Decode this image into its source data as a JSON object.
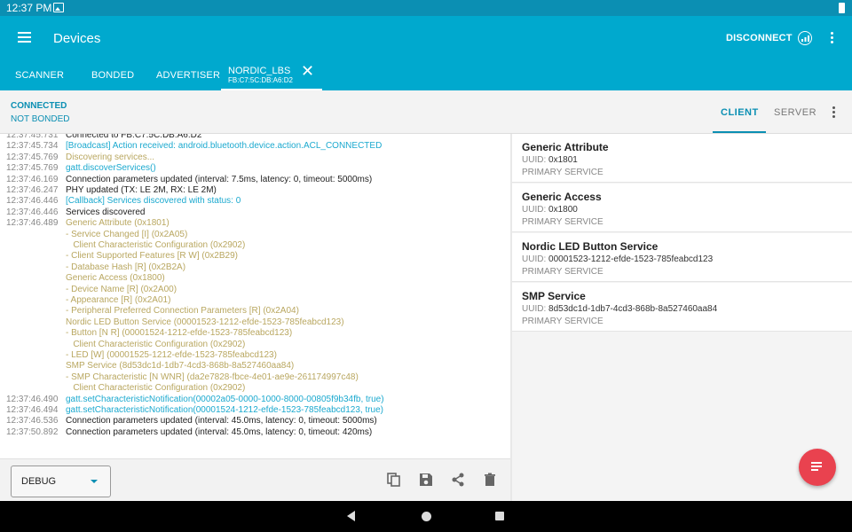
{
  "status_bar": {
    "time": "12:37 PM"
  },
  "app_bar": {
    "title": "Devices",
    "disconnect_label": "DISCONNECT"
  },
  "tabs": {
    "scanner": "SCANNER",
    "bonded": "BONDED",
    "advertiser": "ADVERTISER",
    "device_name": "NORDIC_LBS",
    "device_address": "FB:C7:5C:DB:A6:D2",
    "close_glyph": "✕"
  },
  "connection": {
    "state": "CONNECTED",
    "bond_state": "NOT BONDED",
    "client_tab": "CLIENT",
    "server_tab": "SERVER"
  },
  "log": [
    {
      "ts": "12:37:45.731",
      "msg": "Connected to FB:C7:5C:DB:A6:D2",
      "color": "dark"
    },
    {
      "ts": "12:37:45.734",
      "msg": "[Broadcast] Action received: android.bluetooth.device.action.ACL_CONNECTED",
      "color": "blue"
    },
    {
      "ts": "12:37:45.769",
      "msg": "Discovering services...",
      "color": "olive"
    },
    {
      "ts": "12:37:45.769",
      "msg": "gatt.discoverServices()",
      "color": "blue"
    },
    {
      "ts": "12:37:46.169",
      "msg": "Connection parameters updated (interval: 7.5ms, latency: 0, timeout: 5000ms)",
      "color": "dark"
    },
    {
      "ts": "12:37:46.247",
      "msg": "PHY updated (TX: LE 2M, RX: LE 2M)",
      "color": "dark"
    },
    {
      "ts": "12:37:46.446",
      "msg": "[Callback] Services discovered with status: 0",
      "color": "blue"
    },
    {
      "ts": "12:37:46.446",
      "msg": "Services discovered",
      "color": "dark"
    },
    {
      "ts": "12:37:46.489",
      "msg": "Generic Attribute (0x1801)",
      "color": "olive"
    },
    {
      "ts": "",
      "msg": "- Service Changed [I] (0x2A05)",
      "color": "olive"
    },
    {
      "ts": "",
      "msg": "   Client Characteristic Configuration (0x2902)",
      "color": "olive"
    },
    {
      "ts": "",
      "msg": "- Client Supported Features [R W] (0x2B29)",
      "color": "olive"
    },
    {
      "ts": "",
      "msg": "- Database Hash [R] (0x2B2A)",
      "color": "olive"
    },
    {
      "ts": "",
      "msg": "Generic Access (0x1800)",
      "color": "olive"
    },
    {
      "ts": "",
      "msg": "- Device Name [R] (0x2A00)",
      "color": "olive"
    },
    {
      "ts": "",
      "msg": "- Appearance [R] (0x2A01)",
      "color": "olive"
    },
    {
      "ts": "",
      "msg": "- Peripheral Preferred Connection Parameters [R] (0x2A04)",
      "color": "olive"
    },
    {
      "ts": "",
      "msg": "Nordic LED Button Service (00001523-1212-efde-1523-785feabcd123)",
      "color": "olive"
    },
    {
      "ts": "",
      "msg": "- Button [N R] (00001524-1212-efde-1523-785feabcd123)",
      "color": "olive"
    },
    {
      "ts": "",
      "msg": "   Client Characteristic Configuration (0x2902)",
      "color": "olive"
    },
    {
      "ts": "",
      "msg": "- LED [W] (00001525-1212-efde-1523-785feabcd123)",
      "color": "olive"
    },
    {
      "ts": "",
      "msg": "SMP Service (8d53dc1d-1db7-4cd3-868b-8a527460aa84)",
      "color": "olive"
    },
    {
      "ts": "",
      "msg": "- SMP Characteristic [N WNR] (da2e7828-fbce-4e01-ae9e-261174997c48)",
      "color": "olive"
    },
    {
      "ts": "",
      "msg": "   Client Characteristic Configuration (0x2902)",
      "color": "olive"
    },
    {
      "ts": "12:37:46.490",
      "msg": "gatt.setCharacteristicNotification(00002a05-0000-1000-8000-00805f9b34fb, true)",
      "color": "blue"
    },
    {
      "ts": "12:37:46.494",
      "msg": "gatt.setCharacteristicNotification(00001524-1212-efde-1523-785feabcd123, true)",
      "color": "blue"
    },
    {
      "ts": "12:37:46.536",
      "msg": "Connection parameters updated (interval: 45.0ms, latency: 0, timeout: 5000ms)",
      "color": "dark"
    },
    {
      "ts": "12:37:50.892",
      "msg": "Connection parameters updated (interval: 45.0ms, latency: 0, timeout: 420ms)",
      "color": "dark"
    }
  ],
  "log_toolbar": {
    "log_level": "DEBUG"
  },
  "services": [
    {
      "name": "Generic Attribute",
      "uuid_label": "UUID:",
      "uuid": "0x1801",
      "type": "PRIMARY SERVICE"
    },
    {
      "name": "Generic Access",
      "uuid_label": "UUID:",
      "uuid": "0x1800",
      "type": "PRIMARY SERVICE"
    },
    {
      "name": "Nordic LED Button Service",
      "uuid_label": "UUID:",
      "uuid": "00001523-1212-efde-1523-785feabcd123",
      "type": "PRIMARY SERVICE"
    },
    {
      "name": "SMP Service",
      "uuid_label": "UUID:",
      "uuid": "8d53dc1d-1db7-4cd3-868b-8a527460aa84",
      "type": "PRIMARY SERVICE"
    }
  ],
  "colors": {
    "app_bar": "#00a9ce",
    "status_bar": "#0b8fb3",
    "accent": "#0b8fb3",
    "log_blue": "#1ba9cf",
    "log_olive": "#b9a760",
    "fab": "#e9424f"
  },
  "icons": [
    "menu-icon",
    "image-icon",
    "battery-icon",
    "rssi-icon",
    "more-vert-icon",
    "close-icon",
    "dropdown-caret-icon",
    "copy-icon",
    "save-icon",
    "share-icon",
    "delete-icon",
    "fab-log-icon",
    "nav-back-icon",
    "nav-home-icon",
    "nav-recents-icon"
  ]
}
